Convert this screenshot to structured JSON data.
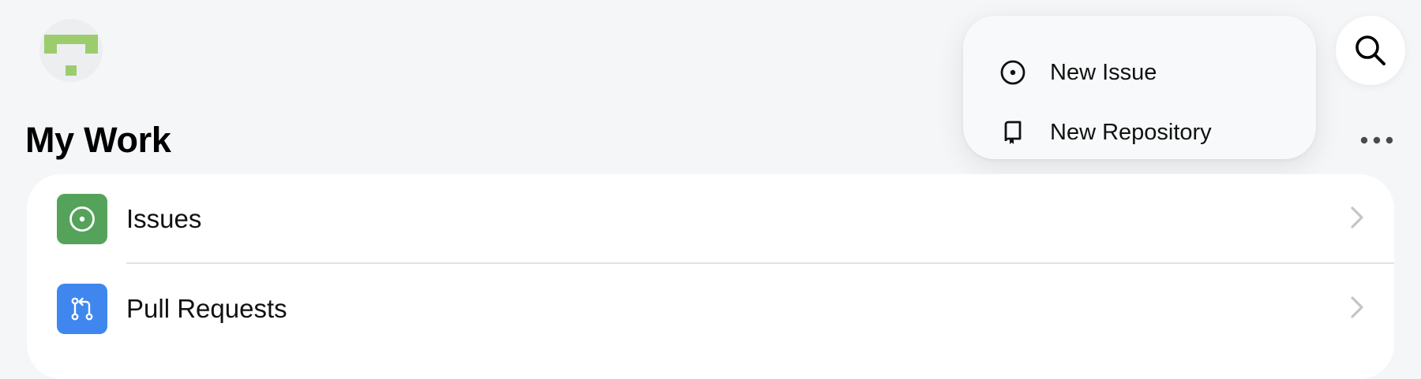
{
  "header": {
    "title": "My Work",
    "avatar": "avatar-identicon",
    "search_icon": "search-icon",
    "more_icon": "more-horizontal-icon"
  },
  "menu": {
    "items": [
      {
        "label": "New Issue",
        "icon": "issue-opened-icon"
      },
      {
        "label": "New Repository",
        "icon": "repo-icon"
      }
    ]
  },
  "my_work": {
    "items": [
      {
        "label": "Issues",
        "icon": "issue-opened-icon",
        "icon_bg": "#55a35a"
      },
      {
        "label": "Pull Requests",
        "icon": "git-pull-request-icon",
        "icon_bg": "#3f87ee"
      }
    ]
  },
  "colors": {
    "background": "#f5f6f8",
    "card": "#ffffff",
    "avatar_green": "#9ccc6e",
    "issues_green": "#55a35a",
    "pr_blue": "#3f87ee"
  }
}
